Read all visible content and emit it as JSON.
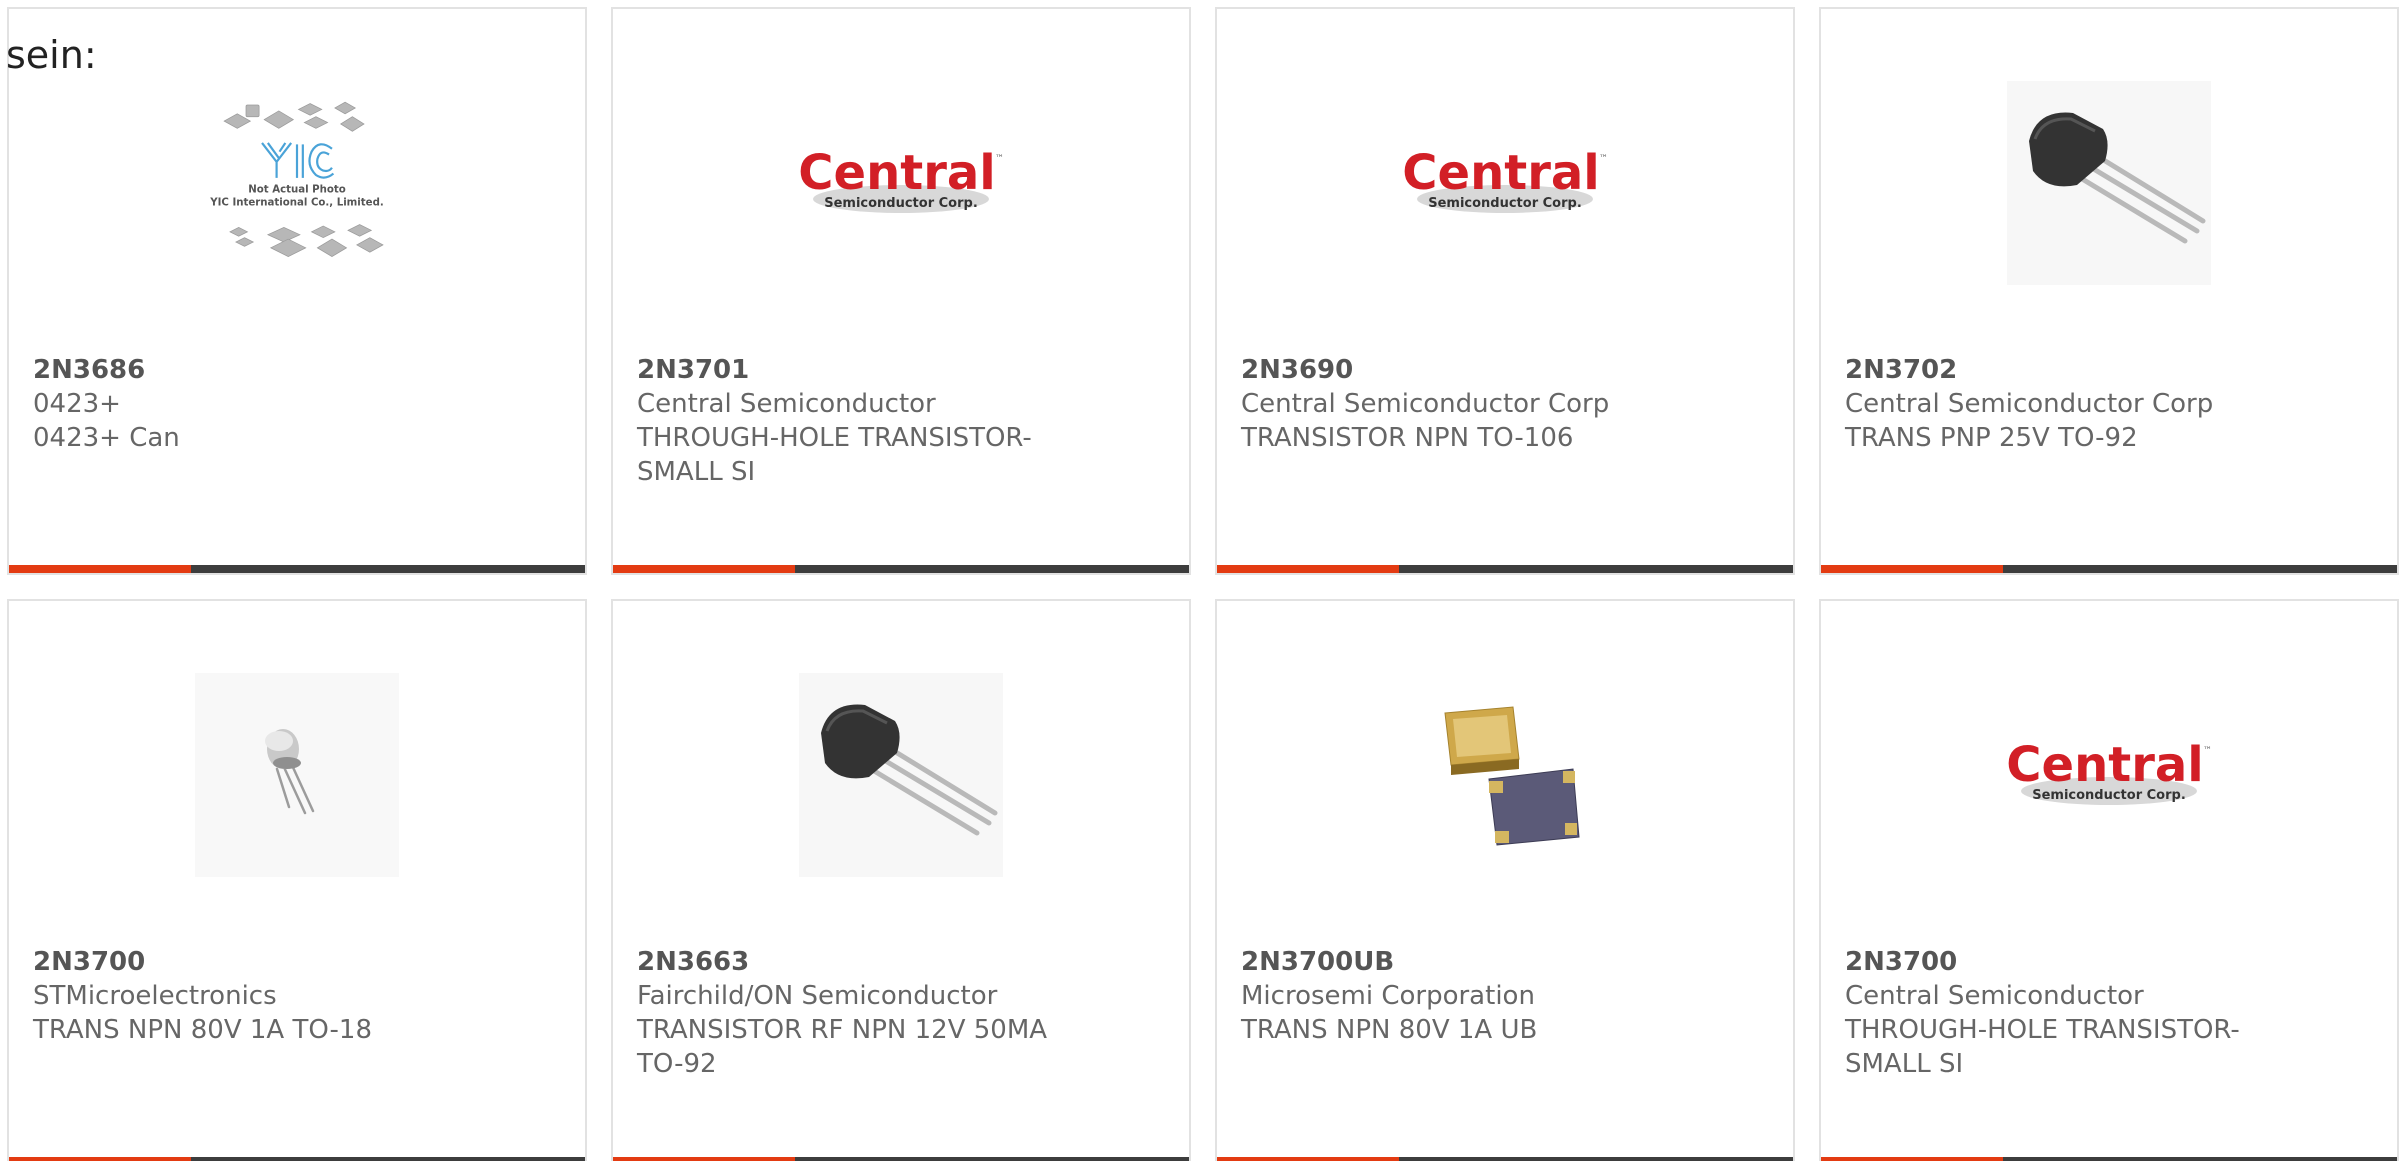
{
  "intro_text": "sein:",
  "products": [
    {
      "part_number": "2N3686",
      "manufacturer": "0423+",
      "description": "0423+ Can",
      "image": "yic-not-actual-photo",
      "image_caption_line1": "Not Actual Photo",
      "image_caption_line2": "YIC International Co., Limited."
    },
    {
      "part_number": "2N3701",
      "manufacturer": "Central Semiconductor",
      "description": "THROUGH-HOLE TRANSISTOR-SMALL SI",
      "image": "central-semiconductor-logo"
    },
    {
      "part_number": "2N3690",
      "manufacturer": "Central Semiconductor Corp",
      "description": "TRANSISTOR NPN TO-106",
      "image": "central-semiconductor-logo"
    },
    {
      "part_number": "2N3702",
      "manufacturer": "Central Semiconductor Corp",
      "description": "TRANS PNP 25V TO-92",
      "image": "to92-transistor"
    },
    {
      "part_number": "2N3700",
      "manufacturer": "STMicroelectronics",
      "description": "TRANS NPN 80V 1A TO-18",
      "image": "to18-can-transistor"
    },
    {
      "part_number": "2N3663",
      "manufacturer": "Fairchild/ON Semiconductor",
      "description": "TRANSISTOR RF NPN 12V 50MA TO-92",
      "image": "to92-transistor"
    },
    {
      "part_number": "2N3700UB",
      "manufacturer": "Microsemi Corporation",
      "description": "TRANS NPN 80V 1A UB",
      "image": "ub-smd-package"
    },
    {
      "part_number": "2N3700",
      "manufacturer": "Central Semiconductor",
      "description": "THROUGH-HOLE TRANSISTOR-SMALL SI",
      "image": "central-semiconductor-logo"
    }
  ],
  "logo": {
    "brand": "Central",
    "tm": "™",
    "sub": "Semiconductor Corp."
  },
  "colors": {
    "accent": "#e33b12",
    "bar": "#3d3d3d",
    "logo_red": "#d21f26"
  }
}
